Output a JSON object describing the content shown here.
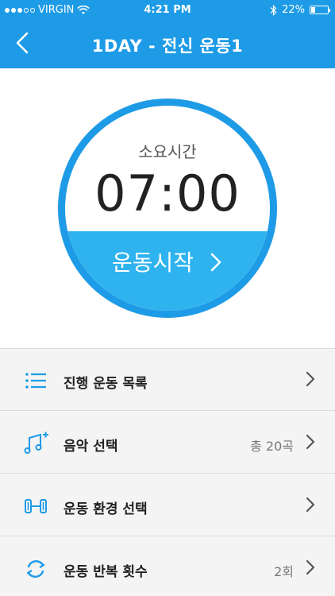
{
  "status_bar": {
    "carrier": "VIRGIN",
    "time": "4:21 PM",
    "battery": "22%",
    "battery_level": 0.22
  },
  "nav": {
    "title": "1DAY - 전신 운동1",
    "back_icon": "chevron-left-icon"
  },
  "timer": {
    "label": "소요시간",
    "value": "07:00",
    "start_label": "운동시작",
    "ring_color": "#1e9be6",
    "button_color": "#2fb3ee"
  },
  "menu": {
    "items": [
      {
        "label": "진행 운동 목록",
        "value": "",
        "icon": "list-icon"
      },
      {
        "label": "음악 선택",
        "value": "총 20곡",
        "icon": "music-add-icon"
      },
      {
        "label": "운동 환경 선택",
        "value": "",
        "icon": "dumbbell-icon"
      },
      {
        "label": "운동 반복 횟수",
        "value": "2회",
        "icon": "repeat-icon"
      }
    ]
  },
  "colors": {
    "accent": "#1e9be6",
    "list_bg": "#f4f4f4",
    "arrow": "#555555"
  }
}
